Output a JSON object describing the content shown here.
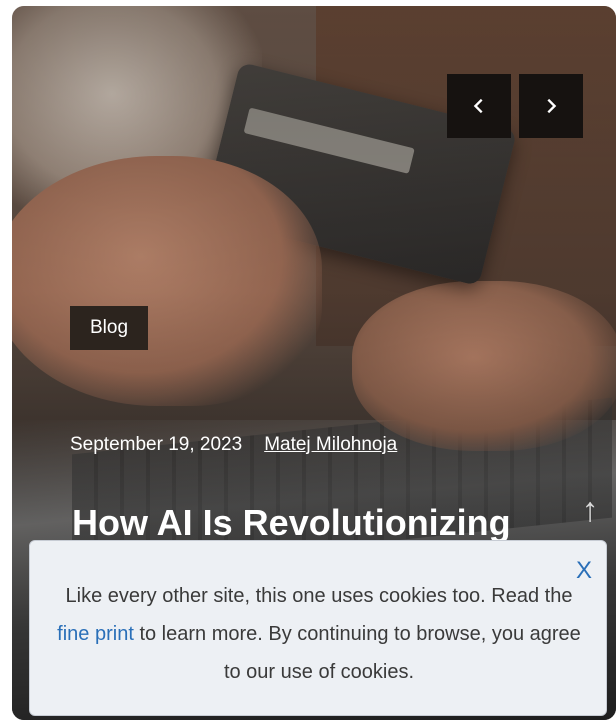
{
  "slider": {
    "prev_symbol": "‹",
    "next_symbol": "›"
  },
  "post": {
    "category": "Blog",
    "date": "September 19, 2023",
    "author": "Matej Milohnoja",
    "title": "How AI Is Revolutionizing eCommerce Email Marketing"
  },
  "scroll_top_symbol": "↑",
  "cookie_notice": {
    "close_label": "X",
    "text_before_link": "Like every other site, this one uses cookies too. Read the ",
    "link_text": "fine print",
    "text_after_link": " to learn more. By continuing to browse, you agree to our use of cookies."
  }
}
